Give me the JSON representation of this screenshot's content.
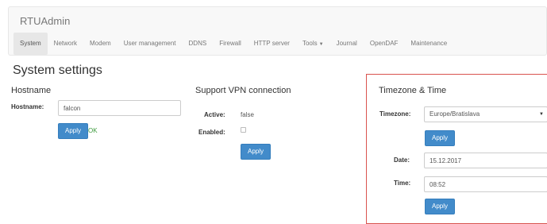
{
  "app": {
    "brand": "RTUAdmin"
  },
  "nav": {
    "items": [
      {
        "label": "System",
        "active": true
      },
      {
        "label": "Network",
        "active": false
      },
      {
        "label": "Modem",
        "active": false
      },
      {
        "label": "User management",
        "active": false
      },
      {
        "label": "DDNS",
        "active": false
      },
      {
        "label": "Firewall",
        "active": false
      },
      {
        "label": "HTTP server",
        "active": false
      },
      {
        "label": "Tools",
        "active": false,
        "dropdown": true
      },
      {
        "label": "Journal",
        "active": false
      },
      {
        "label": "OpenDAF",
        "active": false
      },
      {
        "label": "Maintenance",
        "active": false
      }
    ]
  },
  "page": {
    "title": "System settings"
  },
  "hostname": {
    "title": "Hostname",
    "label": "Hostname:",
    "value": "falcon",
    "apply_label": "Apply",
    "status": "OK"
  },
  "vpn": {
    "title": "Support VPN connection",
    "active_label": "Active:",
    "active_value": "false",
    "enabled_label": "Enabled:",
    "enabled_checked": false,
    "apply_label": "Apply"
  },
  "timezone": {
    "title": "Timezone & Time",
    "timezone_label": "Timezone:",
    "timezone_value": "Europe/Bratislava",
    "timezone_apply_label": "Apply",
    "date_label": "Date:",
    "date_value": "15.12.2017",
    "time_label": "Time:",
    "time_value": "08:52",
    "time_apply_label": "Apply"
  },
  "icons": {
    "select_arrow": "caret-down-icon",
    "tools_dropdown": "caret-down-icon"
  },
  "colors": {
    "primary": "#428bca",
    "ok": "#3c9a3c",
    "highlight_border": "#d9534f"
  }
}
